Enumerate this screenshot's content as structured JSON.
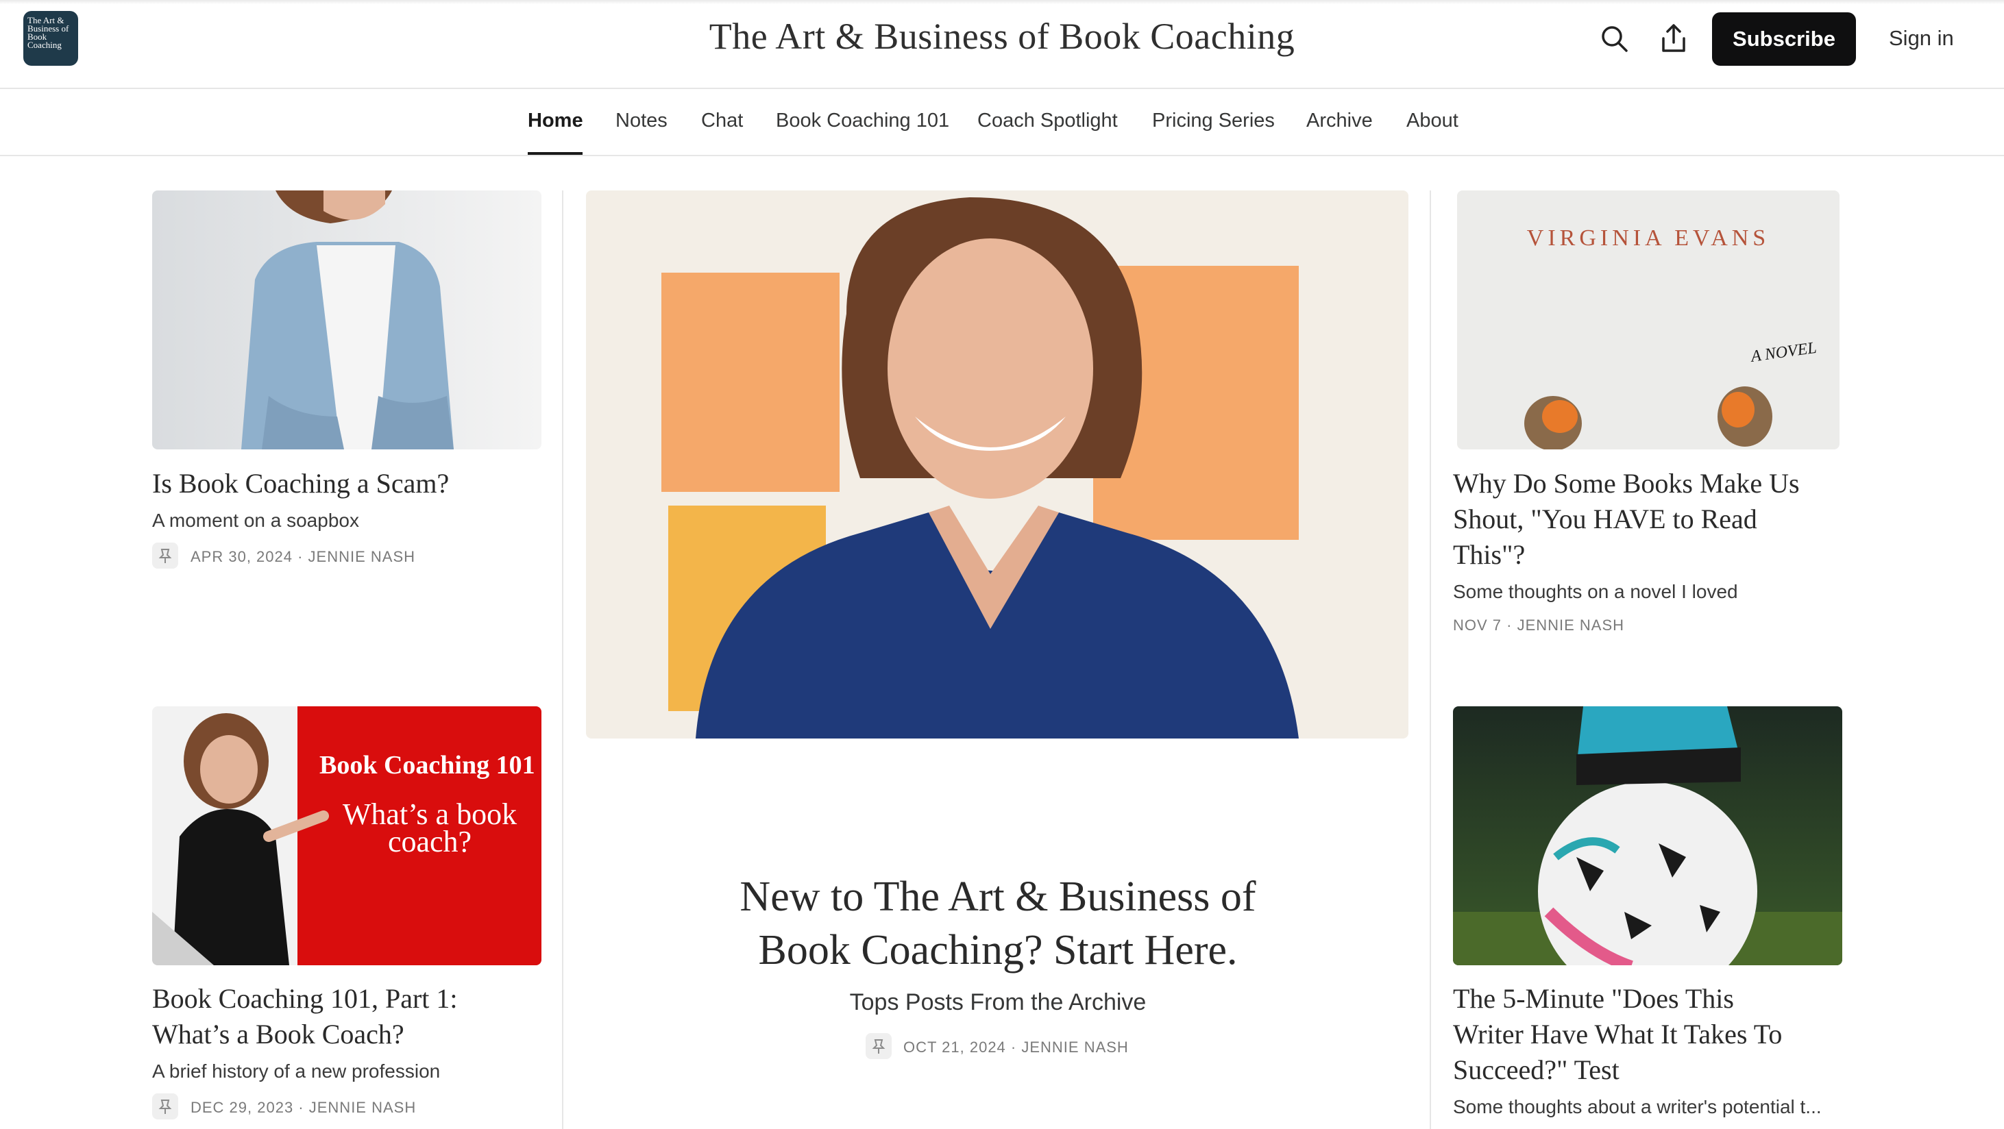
{
  "header": {
    "logo_text": "The Art & Business of Book Coaching",
    "title": "The Art & Business of Book Coaching",
    "subscribe_label": "Subscribe",
    "signin_label": "Sign in",
    "search_icon": "search-icon",
    "share_icon": "share-icon"
  },
  "nav": {
    "items": [
      {
        "label": "Home"
      },
      {
        "label": "Notes"
      },
      {
        "label": "Chat"
      },
      {
        "label": "Book Coaching 101"
      },
      {
        "label": "Coach Spotlight"
      },
      {
        "label": "Pricing Series"
      },
      {
        "label": "Archive"
      },
      {
        "label": "About"
      }
    ],
    "active": "Home"
  },
  "posts": {
    "left1": {
      "title": "Is Book Coaching a Scam?",
      "subtitle": "A moment on a soapbox",
      "meta": "APR 30, 2024 · JENNIE NASH"
    },
    "left2": {
      "title_line1": "Book Coaching 101, Part 1:",
      "title_line2": "What’s a Book Coach?",
      "subtitle": "A brief history of a new profession",
      "meta": "DEC 29, 2023 · JENNIE NASH",
      "thumb_heading": "Book Coaching 101",
      "thumb_line1": "What’s a book",
      "thumb_line2": "coach?"
    },
    "hero": {
      "title_line1": "New to The Art & Business of",
      "title_line2": "Book Coaching? Start Here.",
      "subtitle": "Tops Posts From the Archive",
      "meta": "OCT 21, 2024 · JENNIE NASH"
    },
    "right1": {
      "title_line1": "Why Do Some Books Make Us",
      "title_line2": "Shout, \"You HAVE to Read",
      "title_line3": "This\"?",
      "subtitle": "Some thoughts on a novel I loved",
      "meta": "NOV 7 · JENNIE NASH",
      "thumb_author": "VIRGINIA EVANS",
      "thumb_tag": "A NOVEL"
    },
    "right2": {
      "title_line1": "The 5-Minute \"Does This",
      "title_line2": "Writer Have What It Takes To",
      "title_line3": "Succeed?\" Test",
      "subtitle": "Some thoughts about a writer's potential t..."
    }
  },
  "colors": {
    "accent_dark": "#0f0f10",
    "thumb_red": "#d90d0d",
    "logo_bg": "#1f3a4a"
  }
}
